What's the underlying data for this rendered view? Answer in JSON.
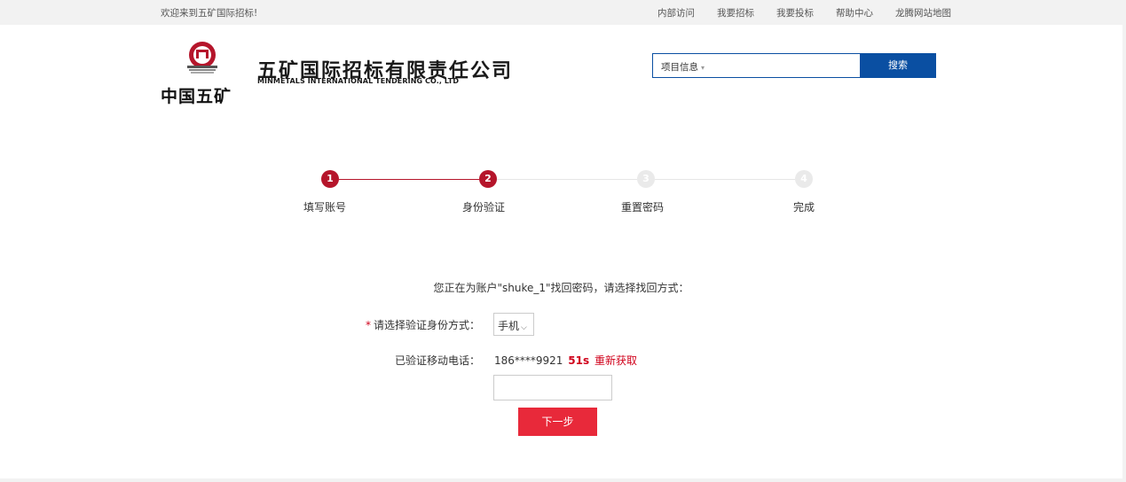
{
  "topbar": {
    "welcome": "欢迎来到五矿国际招标!",
    "links": [
      "内部访问",
      "我要招标",
      "我要投标",
      "帮助中心",
      "龙腾网站地图"
    ]
  },
  "header": {
    "logo_text": "中国五矿",
    "company_cn": "五矿国际招标有限责任公司",
    "company_en": "MINMETALS INTERNATIONAL TENDERING CO., LTD"
  },
  "search": {
    "category": "项目信息",
    "caret": "▾",
    "button": "搜索"
  },
  "steps": [
    {
      "num": "1",
      "label": "填写账号",
      "active": true
    },
    {
      "num": "2",
      "label": "身份验证",
      "active": true
    },
    {
      "num": "3",
      "label": "重置密码",
      "active": false
    },
    {
      "num": "4",
      "label": "完成",
      "active": false
    }
  ],
  "form": {
    "notice": "您正在为账户\"shuke_1\"找回密码，请选择找回方式：",
    "required_mark": "*",
    "method_label": "请选择验证身份方式：",
    "method_value": "手机",
    "method_chevron": "⌵",
    "phone_label": "已验证移动电话：",
    "phone_value": "186****9921",
    "countdown": "51s",
    "resend": "重新获取",
    "code_value": "",
    "next_button": "下一步"
  },
  "colors": {
    "brand_blue": "#0a4fa2",
    "accent_red": "#b5152b",
    "button_red": "#e8293a"
  }
}
